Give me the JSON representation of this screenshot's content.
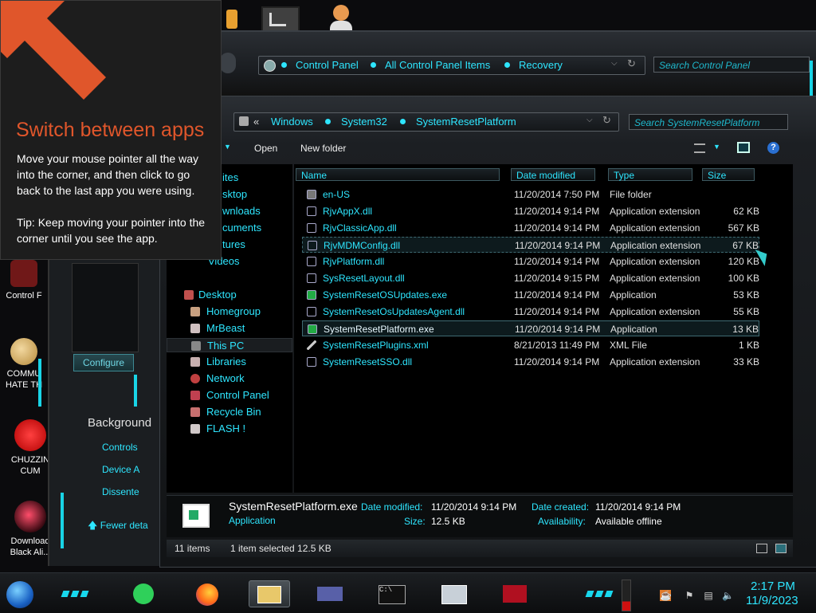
{
  "desktop": {
    "icons": [
      {
        "label_line1": "Control F",
        "label_line2": ""
      },
      {
        "label_line1": "COMMU",
        "label_line2": "HATE TH"
      },
      {
        "label_line1": "CHUZZIN",
        "label_line2": "CUM"
      },
      {
        "label_line1": "Download",
        "label_line2": "Black Ali..."
      }
    ]
  },
  "control_panel_window": {
    "breadcrumbs": [
      "Control Panel",
      "All Control Panel Items",
      "Recovery"
    ],
    "search_placeholder": "Search Control Panel",
    "side_panel": {
      "configure_label": "Configure",
      "background_label": "Background",
      "links": [
        "Controls",
        "Device A",
        "Dissente"
      ],
      "fewer_details": "Fewer deta"
    }
  },
  "explorer_window": {
    "breadcrumb_prefix": "«",
    "breadcrumbs": [
      "Windows",
      "System32",
      "SystemResetPlatform"
    ],
    "search_placeholder": "Search SystemResetPlatform",
    "toolbar": {
      "open": "Open",
      "new_folder": "New folder"
    },
    "nav_items": [
      {
        "label": "ites",
        "color": "#2ee6ff"
      },
      {
        "label": "sktop",
        "color": "#2ee6ff"
      },
      {
        "label": "wnloads",
        "color": "#2ee6ff"
      },
      {
        "label": "cuments",
        "color": "#2ee6ff"
      },
      {
        "label": "tures",
        "color": "#2ee6ff"
      },
      {
        "label": "Videos",
        "color": "#2ee6ff"
      }
    ],
    "nav_tree": [
      {
        "label": "Desktop",
        "icon_color": "#c0504d"
      },
      {
        "label": "Homegroup",
        "icon_color": "#c8a080"
      },
      {
        "label": "MrBeast",
        "icon_color": "#d0c0c0"
      },
      {
        "label": "This PC",
        "icon_color": "#888888",
        "selected": true
      },
      {
        "label": "Libraries",
        "icon_color": "#c8b0b0"
      },
      {
        "label": "Network",
        "icon_color": "#c04040"
      },
      {
        "label": "Control Panel",
        "icon_color": "#c04050"
      },
      {
        "label": "Recycle Bin",
        "icon_color": "#c87070"
      },
      {
        "label": "FLASH !",
        "icon_color": "#d0c8c8"
      }
    ],
    "columns": {
      "name": "Name",
      "date": "Date modified",
      "type": "Type",
      "size": "Size"
    },
    "files": [
      {
        "name": "en-US",
        "date": "11/20/2014 7:50 PM",
        "type": "File folder",
        "size": ""
      },
      {
        "name": "RjvAppX.dll",
        "date": "11/20/2014 9:14 PM",
        "type": "Application extension",
        "size": "62 KB"
      },
      {
        "name": "RjvClassicApp.dll",
        "date": "11/20/2014 9:14 PM",
        "type": "Application extension",
        "size": "567 KB"
      },
      {
        "name": "RjvMDMConfig.dll",
        "date": "11/20/2014 9:14 PM",
        "type": "Application extension",
        "size": "67 KB"
      },
      {
        "name": "RjvPlatform.dll",
        "date": "11/20/2014 9:14 PM",
        "type": "Application extension",
        "size": "120 KB"
      },
      {
        "name": "SysResetLayout.dll",
        "date": "11/20/2014 9:15 PM",
        "type": "Application extension",
        "size": "100 KB"
      },
      {
        "name": "SystemResetOSUpdates.exe",
        "date": "11/20/2014 9:14 PM",
        "type": "Application",
        "size": "53 KB"
      },
      {
        "name": "SystemResetOsUpdatesAgent.dll",
        "date": "11/20/2014 9:14 PM",
        "type": "Application extension",
        "size": "55 KB"
      },
      {
        "name": "SystemResetPlatform.exe",
        "date": "11/20/2014 9:14 PM",
        "type": "Application",
        "size": "13 KB"
      },
      {
        "name": "SystemResetPlugins.xml",
        "date": "8/21/2013 11:49 PM",
        "type": "XML File",
        "size": "1 KB"
      },
      {
        "name": "SystemResetSSO.dll",
        "date": "11/20/2014 9:14 PM",
        "type": "Application extension",
        "size": "33 KB"
      }
    ],
    "details": {
      "filename": "SystemResetPlatform.exe",
      "kind": "Application",
      "date_modified_label": "Date modified:",
      "date_modified": "11/20/2014 9:14 PM",
      "size_label": "Size:",
      "size": "12.5 KB",
      "date_created_label": "Date created:",
      "date_created": "11/20/2014 9:14 PM",
      "availability_label": "Availability:",
      "availability": "Available offline"
    },
    "status": {
      "items": "11 items",
      "selected": "1 item selected  12.5 KB"
    }
  },
  "tip": {
    "title": "Switch between apps",
    "body": "Move your mouse pointer all the way into the corner, and then click to go back to the last app you were using.",
    "tip": "Tip: Keep moving your pointer into the corner until you see the app."
  },
  "taskbar": {
    "time": "2:17 PM",
    "date": "11/9/2023"
  },
  "colors": {
    "accent": "#2ee6ff",
    "tip_arrow": "#e0562b"
  }
}
